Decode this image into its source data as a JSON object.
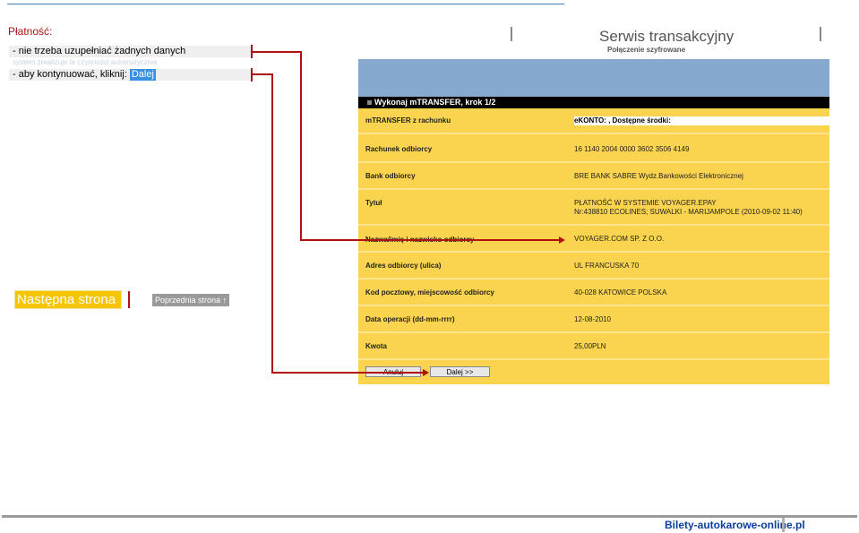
{
  "heading": "Płatność:",
  "notes": [
    "- nie trzeba uzupełniać żadnych danych",
    "- aby kontynuować, kliknij: "
  ],
  "ghost_text": "system zrealizuje te czynności automatycznie",
  "dalej_label": "Dalej",
  "nav": {
    "next": "Następna strona ↓",
    "prev": "Poprzednia strona ↑"
  },
  "bank": {
    "title": "Serwis transakcyjny",
    "subtitle": "Połączenie szyfrowane",
    "step": "Wykonaj mTRANSFER, krok 1/2",
    "account_label": "mTRANSFER z rachunku",
    "account_value": "eKONTO:                  , Dostępne środki:",
    "rows": [
      {
        "label": "Rachunek odbiorcy",
        "value": "16 1140 2004 0000 3602 3506 4149"
      },
      {
        "label": "Bank odbiorcy",
        "value": "BRE BANK SABRE Wydz.Bankowości Elektronicznej"
      },
      {
        "label": "Tytuł",
        "value": "PŁATNOŚĆ W SYSTEMIE VOYAGER.EPAY",
        "value2": "Nr:438810 ECOLINES; SUWALKI - MARIJAMPOLE (2010-09-02 11:40)"
      },
      {
        "label": "Nazwa/imię i nazwisko odbiorcy",
        "value": "VOYAGER.COM SP. Z O.O."
      },
      {
        "label": "Adres odbiorcy (ulica)",
        "value": "UL FRANCUSKA 70"
      },
      {
        "label": "Kod pocztowy, miejscowość odbiorcy",
        "value": "40-028 KATOWICE POLSKA"
      },
      {
        "label": "Data operacji (dd-mm-rrrr)",
        "value": "12-08-2010"
      },
      {
        "label": "Kwota",
        "value": "25,00PLN"
      }
    ],
    "cancel_label": "Anuluj",
    "next_label": "Dalej >>"
  },
  "footer": "Bilety-autokarowe-online.pl",
  "colors": {
    "accent_red": "#b01010",
    "bank_yellow": "#fad44e",
    "nav_yellow": "#f7c400"
  }
}
